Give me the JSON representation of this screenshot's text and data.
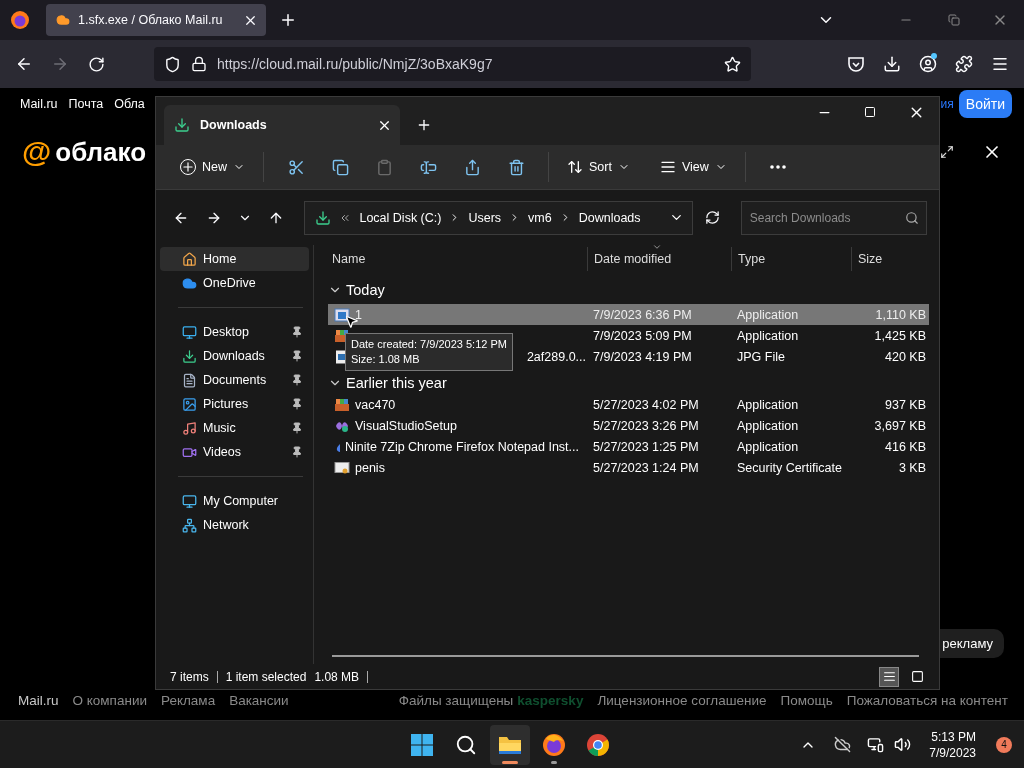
{
  "browser": {
    "tab": {
      "title": "1.sfx.exe / Облако Mail.ru"
    },
    "url": "https://cloud.mail.ru/public/NmjZ/3oBxaK9g7",
    "account_dot": true
  },
  "site": {
    "nav_links": [
      "Mail.ru",
      "Почта",
      "Обла"
    ],
    "nav_cut": "ия",
    "login": "Войти",
    "logo": {
      "mark": "@",
      "text": "облако"
    },
    "ad_button": "рекламу",
    "footer_left": [
      "Mail.ru",
      "О компании",
      "Реклама",
      "Вакансии"
    ],
    "protected": "Файлы защищены",
    "brand": "kaspersky",
    "footer_right": [
      "Лицензионное соглашение",
      "Помощь",
      "Пожаловаться на контент"
    ]
  },
  "explorer": {
    "tab": "Downloads",
    "toolbar": {
      "new": "New",
      "actions": [
        {
          "kind": "cut",
          "disabled": false
        },
        {
          "kind": "copy",
          "disabled": false
        },
        {
          "kind": "paste",
          "disabled": true
        },
        {
          "kind": "rename",
          "disabled": false
        },
        {
          "kind": "share",
          "disabled": false
        },
        {
          "kind": "delete",
          "disabled": false
        }
      ],
      "sort": "Sort",
      "view": "View"
    },
    "breadcrumb": [
      "Local Disk (C:)",
      "Users",
      "vm6",
      "Downloads"
    ],
    "search": {
      "placeholder": "Search Downloads"
    },
    "sidebar": [
      {
        "items": [
          {
            "label": "Home",
            "kind": "home",
            "selected": true,
            "pinned": false
          },
          {
            "label": "OneDrive",
            "kind": "onedrive",
            "selected": false,
            "pinned": false
          }
        ]
      },
      {
        "items": [
          {
            "label": "Desktop",
            "kind": "desktop",
            "selected": false,
            "pinned": true
          },
          {
            "label": "Downloads",
            "kind": "downloads",
            "selected": false,
            "pinned": true
          },
          {
            "label": "Documents",
            "kind": "documents",
            "selected": false,
            "pinned": true
          },
          {
            "label": "Pictures",
            "kind": "pictures",
            "selected": false,
            "pinned": true
          },
          {
            "label": "Music",
            "kind": "music",
            "selected": false,
            "pinned": true
          },
          {
            "label": "Videos",
            "kind": "videos",
            "selected": false,
            "pinned": true
          }
        ]
      },
      {
        "items": [
          {
            "label": "My Computer",
            "kind": "computer",
            "selected": false,
            "pinned": false
          },
          {
            "label": "Network",
            "kind": "network",
            "selected": false,
            "pinned": false
          }
        ]
      }
    ],
    "columns": [
      "Name",
      "Date modified",
      "Type",
      "Size"
    ],
    "groups": [
      {
        "label": "Today",
        "expanded": true,
        "files": [
          {
            "name": "1",
            "kind": "application",
            "date": "7/9/2023 6:36 PM",
            "type": "Application",
            "size": "1,110 KB",
            "selected": true
          },
          {
            "kind": "installer",
            "date": "7/9/2023 5:09 PM",
            "type": "Application",
            "size": "1,425 KB",
            "selected": false
          },
          {
            "name": "2af289.0...",
            "name_covered": true,
            "kind": "image",
            "date": "7/9/2023 4:19 PM",
            "type": "JPG File",
            "size": "420 KB",
            "selected": false
          }
        ]
      },
      {
        "label": "Earlier this year",
        "expanded": true,
        "files": [
          {
            "name": "vac470",
            "kind": "installer",
            "date": "5/27/2023 4:02 PM",
            "type": "Application",
            "size": "937 KB",
            "selected": false
          },
          {
            "name": "VisualStudioSetup",
            "kind": "studio",
            "date": "5/27/2023 3:26 PM",
            "type": "Application",
            "size": "3,697 KB",
            "selected": false
          },
          {
            "name": "Ninite 7Zip Chrome Firefox Notepad Inst...",
            "kind": "ninite",
            "date": "5/27/2023 1:25 PM",
            "type": "Application",
            "size": "416 KB",
            "selected": false
          },
          {
            "name": "penis",
            "kind": "certificate",
            "date": "5/27/2023 1:24 PM",
            "type": "Security Certificate",
            "size": "3 KB",
            "selected": false
          }
        ]
      }
    ],
    "tooltip": [
      "Date created: 7/9/2023 5:12 PM",
      "Size: 1.08 MB"
    ],
    "status": {
      "count": "7 items",
      "selection": "1 item selected",
      "size": "1.08 MB",
      "views": [
        {
          "kind": "details",
          "selected": true
        },
        {
          "kind": "tiles",
          "selected": false
        }
      ]
    }
  },
  "taskbar": {
    "apps": [
      {
        "kind": "start",
        "active": false,
        "running": false
      },
      {
        "kind": "search",
        "active": false,
        "running": false
      },
      {
        "kind": "explorer",
        "active": true,
        "running": true
      },
      {
        "kind": "firefox",
        "active": false,
        "running": true
      },
      {
        "kind": "chrome",
        "active": false,
        "running": false
      }
    ],
    "time": "5:13 PM",
    "date": "7/9/2023",
    "notifications": "4"
  }
}
